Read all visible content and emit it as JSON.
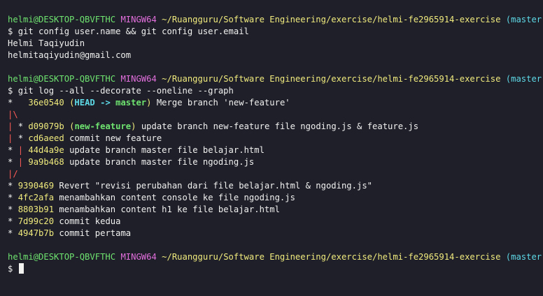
{
  "prompt": {
    "user_host": "helmi@DESKTOP-QBVFTHC",
    "shell": "MINGW64",
    "path": "~/Ruangguru/Software Engineering/exercise/helmi-fe2965914-exercise",
    "branch": "(master)",
    "dollar": "$"
  },
  "block1": {
    "command": "git config user.name && git config user.email",
    "out_name": "Helmi Taqiyudin",
    "out_email": "helmitaqiyudin@gmail.com"
  },
  "block2": {
    "command": "git log --all --decorate --oneline --graph",
    "log": [
      {
        "graph": "*",
        "hash": "36e0540",
        "refs": [
          {
            "text": "HEAD -> ",
            "style": "cyan"
          },
          {
            "text": "master",
            "style": "green"
          }
        ],
        "message": "Merge branch 'new-feature'"
      },
      {
        "graph": "|\\"
      },
      {
        "graph": "| *",
        "hash": "d09079b",
        "refs": [
          {
            "text": "new-feature",
            "style": "green"
          }
        ],
        "message": "update branch new-feature file ngoding.js & feature.js"
      },
      {
        "graph": "| *",
        "hash": "cd6aeed",
        "message": "commit new feature"
      },
      {
        "graph": "* |",
        "hash": "44d4a9e",
        "message": "update branch master file belajar.html"
      },
      {
        "graph": "* |",
        "hash": "9a9b468",
        "message": "update branch master file ngoding.js"
      },
      {
        "graph": "|/"
      },
      {
        "graph": "*",
        "hash": "9390469",
        "message": "Revert \"revisi perubahan dari file belajar.html & ngoding.js\""
      },
      {
        "graph": "*",
        "hash": "4fc2afa",
        "message": "menambahkan content console ke file ngoding.js"
      },
      {
        "graph": "*",
        "hash": "8803b91",
        "message": "menambahkan content h1 ke file belajar.html"
      },
      {
        "graph": "*",
        "hash": "7d99c20",
        "message": "commit kedua"
      },
      {
        "graph": "*",
        "hash": "4947b7b",
        "message": "commit pertama"
      }
    ]
  },
  "colors": {
    "background": "#1e1f29",
    "text": "#f1f1f0",
    "user_host": "#6fe36f",
    "shell": "#e36fdd",
    "path": "#f0ea7d",
    "branch": "#5ed9e6",
    "graph_branch_line": "#ff5c57"
  }
}
